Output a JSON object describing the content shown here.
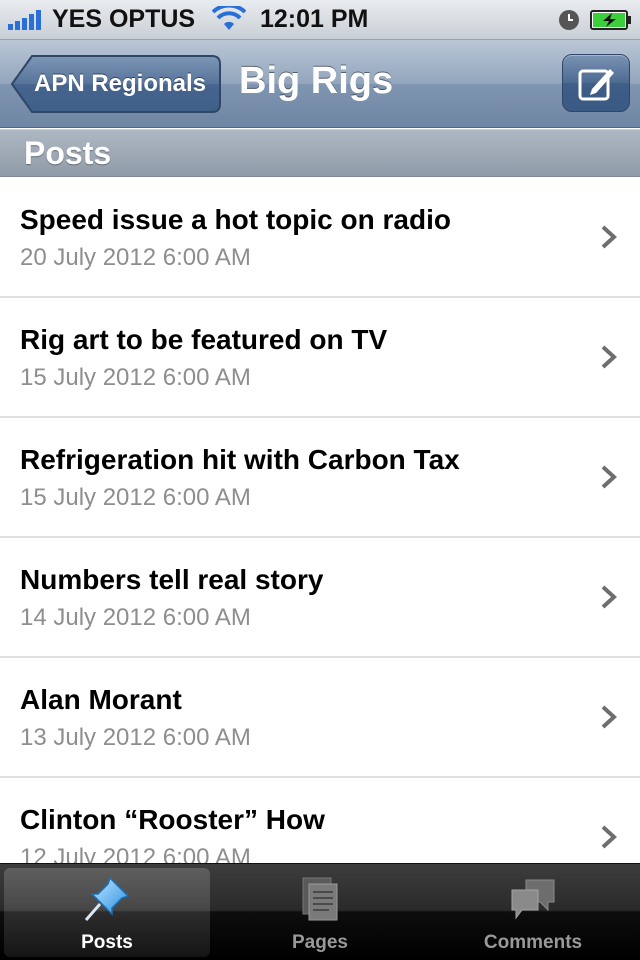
{
  "status_bar": {
    "carrier": "YES OPTUS",
    "time": "12:01 PM"
  },
  "nav": {
    "back_label": "APN Regionals",
    "title": "Big Rigs"
  },
  "section": {
    "title": "Posts"
  },
  "posts": [
    {
      "title": "Speed issue a hot topic on radio",
      "date": "20 July 2012 6:00 AM"
    },
    {
      "title": "Rig art to be featured on TV",
      "date": "15 July 2012 6:00 AM"
    },
    {
      "title": "Refrigeration hit with Carbon Tax",
      "date": "15 July 2012 6:00 AM"
    },
    {
      "title": "Numbers tell real story",
      "date": "14 July 2012 6:00 AM"
    },
    {
      "title": "Alan Morant",
      "date": "13 July 2012 6:00 AM"
    },
    {
      "title": "Clinton “Rooster” How",
      "date": "12 July 2012 6:00 AM"
    }
  ],
  "tabs": [
    {
      "label": "Posts",
      "icon": "pushpin-icon",
      "active": true
    },
    {
      "label": "Pages",
      "icon": "pages-icon",
      "active": false
    },
    {
      "label": "Comments",
      "icon": "comments-icon",
      "active": false
    }
  ],
  "colors": {
    "nav_accent": "#6f86a4",
    "date_text": "#8e8e8e",
    "battery_charge": "#3ccf3c"
  }
}
